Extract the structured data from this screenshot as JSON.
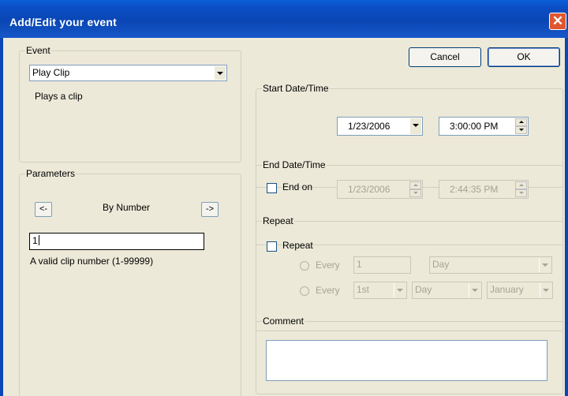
{
  "window": {
    "title": "Add/Edit your event",
    "close_glyph": "✕"
  },
  "buttons": {
    "cancel": "Cancel",
    "ok": "OK"
  },
  "event": {
    "legend": "Event",
    "selected": "Play Clip",
    "description": "Plays a clip"
  },
  "parameters": {
    "legend": "Parameters",
    "prev": "<-",
    "next": "->",
    "mode": "By Number",
    "value": "1",
    "hint": "A valid clip number (1-99999)"
  },
  "start": {
    "legend": "Start Date/Time",
    "date": "1/23/2006",
    "time": "3:00:00 PM"
  },
  "end": {
    "legend": "End Date/Time",
    "checkbox_label": "End on",
    "checked": false,
    "date": "1/23/2006",
    "time": "2:44:35 PM"
  },
  "repeat": {
    "legend": "Repeat",
    "checkbox_label": "Repeat",
    "checked": false,
    "every_label": "Every",
    "row1": {
      "count": "1",
      "unit": "Day"
    },
    "row2": {
      "ordinal": "1st",
      "unit": "Day",
      "month": "January"
    }
  },
  "comment": {
    "legend": "Comment",
    "value": ""
  }
}
